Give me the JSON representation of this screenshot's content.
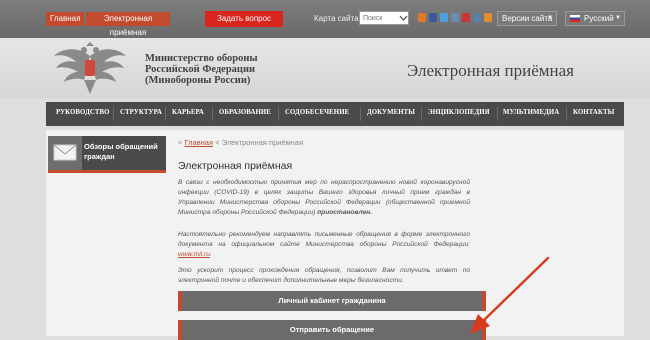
{
  "topbar": {
    "home_label": "Главная",
    "reception_label": "Электронная приёмная",
    "ask_label": "Задать вопрос",
    "sitemap_label": "Карта сайта",
    "search_placeholder": "Поиск",
    "versions_label": "Версии сайта",
    "language_label": "Русский"
  },
  "header": {
    "ministry_line1": "Министерство обороны",
    "ministry_line2": "Российской Федерации",
    "ministry_line3": "(Минобороны России)",
    "title": "Электронная приёмная"
  },
  "nav": {
    "items": [
      "РУКОВОДСТВО",
      "СТРУКТУРА",
      "КАРЬЕРА",
      "ОБРАЗОВАНИЕ",
      "СОДОБЕСЕЧЕНИЕ",
      "ДОКУМЕНТЫ",
      "ЭНЦИКЛОПЕДИЯ",
      "МУЛЬТИМЕДИА",
      "КОНТАКТЫ"
    ]
  },
  "sidebar": {
    "card_label": "Обзоры обращений граждан"
  },
  "breadcrumb": {
    "prefix": "<",
    "home": "Главная",
    "current": "< Электронная приёмная"
  },
  "content": {
    "title": "Электронная приёмная",
    "para1_text": "В связи с необходимостью принятия мер по нераспространению новой коронавирусной инфекции (COVID-19) в целях защиты Вашего здоровья личный прием граждан в Управлении Министерства обороны Российской Федерации (общественной приемной Министра обороны Российской Федерации) ",
    "para1_bold": "приостановлен.",
    "para2_text": "Настоятельно рекомендуем направлять письменные обращения в форме электронного документа на официальном сайте Министерства обороны Российской Федерации: ",
    "para2_link": "www.mil.ru",
    "para2_end": ".",
    "para3_text": "Это ускорит процесс прохождения обращения, позволит Вам получить ответ по электронной почте и обеспечит дополнительные меры безопасности.",
    "cabinet_button": "Личный кабинет гражданина",
    "send_button": "Отправить обращение"
  },
  "colors": {
    "accent": "#c24a2d",
    "ask_red": "#d8241d",
    "nav_bg": "#4a4a4a",
    "arrow": "#d63b1f"
  }
}
